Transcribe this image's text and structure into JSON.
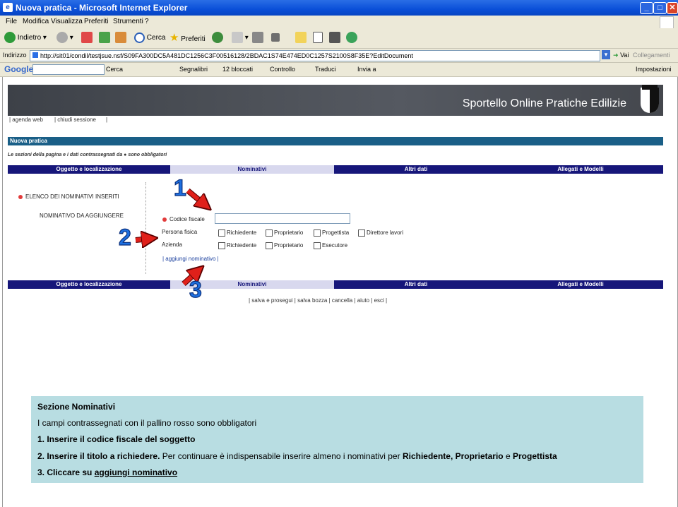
{
  "window": {
    "title": "Nuova pratica - Microsoft Internet Explorer",
    "minimize": "_",
    "maximize": "□",
    "close": "✕"
  },
  "menu": [
    "File",
    "Modifica",
    "Visualizza",
    "Preferiti",
    "Strumenti",
    "?"
  ],
  "toolbar": {
    "back": "Indietro",
    "search": "Cerca",
    "favorites": "Preferiti"
  },
  "address": {
    "label": "Indirizzo",
    "url": "http://sit01/condil/testjsue.nsf/S09FA300DC5A481DC1256C3F00516128/2BDAC1S74E474ED0C1257S2100S8F35E?EditDocument",
    "go": "Vai",
    "links": "Collegamenti"
  },
  "googlebar": {
    "logo": "Google",
    "search": "Cerca",
    "bookmarks": "Segnalibri",
    "blocked": "12 bloccati",
    "check": "Controllo",
    "translate": "Traduci",
    "send": "Invia a",
    "settings": "Impostazioni"
  },
  "page": {
    "site_title": "Sportello Online Pratiche Edilizie",
    "nav": [
      "| agenda web",
      "| chiudi sessione",
      "|"
    ],
    "banner": "Nuova pratica",
    "legend": "Le sezioni della pagina e i dati contrassegnati da ● sono obbligatori",
    "tabs": [
      "Oggetto e localizzazione",
      "Nominativi",
      "Altri dati",
      "Allegati e Modelli"
    ],
    "list_title": "ELENCO DEI NOMINATIVI INSERITI",
    "add_title": "NOMINATIVO DA AGGIUNGERE",
    "codice_fiscale": "Codice fiscale",
    "persona_fisica": "Persona fisica",
    "azienda": "Azienda",
    "persona_roles": [
      "Richiedente",
      "Proprietario",
      "Progettista",
      "Direttore lavori"
    ],
    "azienda_roles": [
      "Richiedente",
      "Proprietario",
      "Esecutore"
    ],
    "add_link": "| aggiungi nominativo |",
    "bottom_links": "| salva e prosegui | salva bozza | cancella | aiuto | esci |"
  },
  "callouts": [
    "1",
    "2",
    "3"
  ],
  "info": {
    "title": "Sezione Nominativi",
    "line1": "I campi contrassegnati con il pallino rosso sono obbligatori",
    "step1": "1. Inserire il codice fiscale del soggetto",
    "step2_bold": "2. Inserire il titolo a richiedere.",
    "step2_rest": " Per continuare è indispensabile inserire almeno i nominativi per ",
    "step2_roles": "Richiedente, Proprietario",
    "step2_and": " e ",
    "step2_last": "Progettista",
    "step3_prefix": "3. Cliccare su ",
    "step3_link": "aggiungi nominativo"
  },
  "colors": {
    "titlebar": "#0a4fd8",
    "nav_tabs": "#16167a",
    "banner": "#1a5f87",
    "info_bg": "#b8dde2",
    "callout": "#1d6fe0",
    "arrow": "#e0201a"
  }
}
